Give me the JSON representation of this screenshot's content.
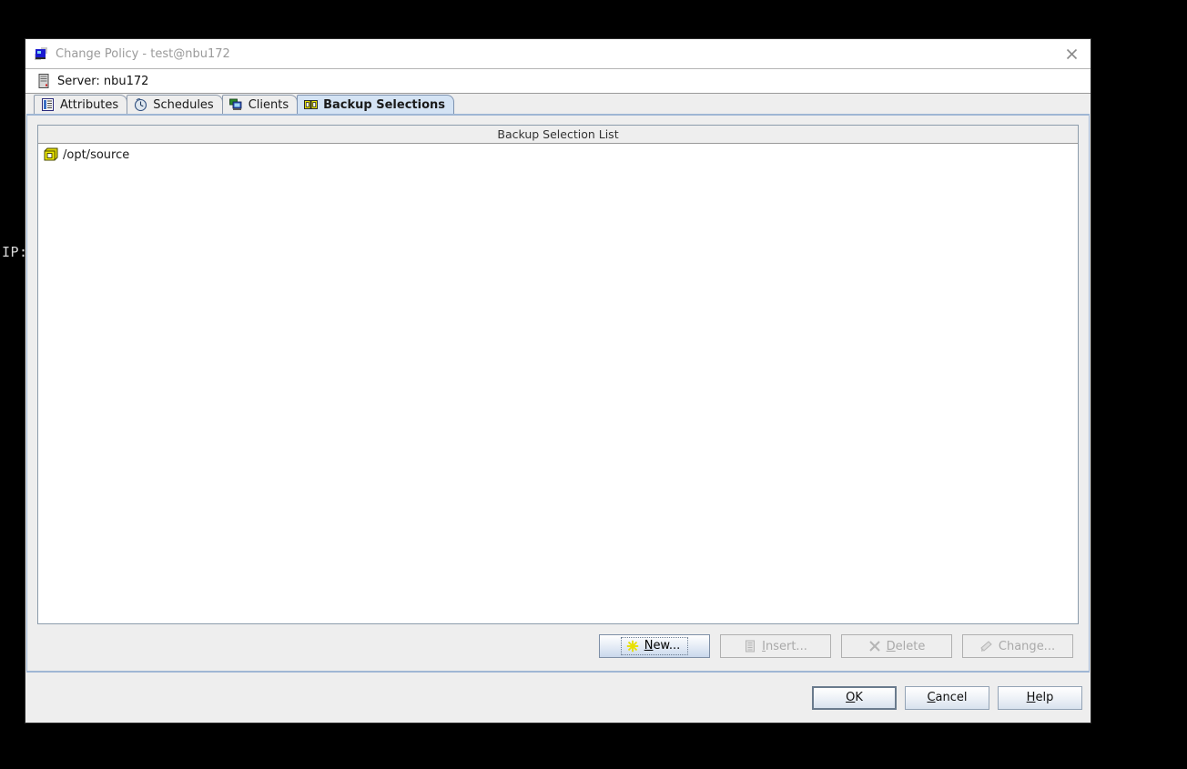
{
  "desktop": {
    "background_color": "#000000",
    "terminal_text": "IP:"
  },
  "dialog": {
    "title": "Change Policy - test@nbu172",
    "title_icon": "policy-window-icon",
    "close_icon": "close-icon",
    "server_bar": {
      "icon": "server-icon",
      "label": "Server: nbu172"
    },
    "tabs": [
      {
        "label": "Attributes",
        "icon": "attributes-icon",
        "active": false
      },
      {
        "label": "Schedules",
        "icon": "clock-icon",
        "active": false
      },
      {
        "label": "Clients",
        "icon": "clients-icon",
        "active": false
      },
      {
        "label": "Backup Selections",
        "icon": "selections-icon",
        "active": true
      }
    ],
    "backup_selections": {
      "list_header": "Backup Selection List",
      "items": [
        {
          "icon": "directory-box-icon",
          "path": "/opt/source"
        }
      ],
      "action_buttons": [
        {
          "label": "New...",
          "icon": "new-star-icon",
          "mnemonic": "N",
          "enabled": true
        },
        {
          "label": "Insert...",
          "icon": "insert-doc-icon",
          "mnemonic": "I",
          "enabled": false
        },
        {
          "label": "Delete",
          "icon": "delete-x-icon",
          "mnemonic": "D",
          "enabled": false
        },
        {
          "label": "Change...",
          "icon": "change-pen-icon",
          "mnemonic": "g",
          "enabled": false
        }
      ]
    },
    "dialog_buttons": [
      {
        "label": "OK",
        "mnemonic": "O",
        "focused": true
      },
      {
        "label": "Cancel",
        "mnemonic": "C",
        "focused": false
      },
      {
        "label": "Help",
        "mnemonic": "H",
        "focused": false
      }
    ]
  },
  "colors": {
    "dialog_bg": "#eeeeee",
    "panel_border": "#9fb6d4",
    "active_tab_bg": "#d4e3f4",
    "list_bg": "#ffffff",
    "icon_yellow": "#e8e000",
    "title_text": "#9a9a9a"
  }
}
